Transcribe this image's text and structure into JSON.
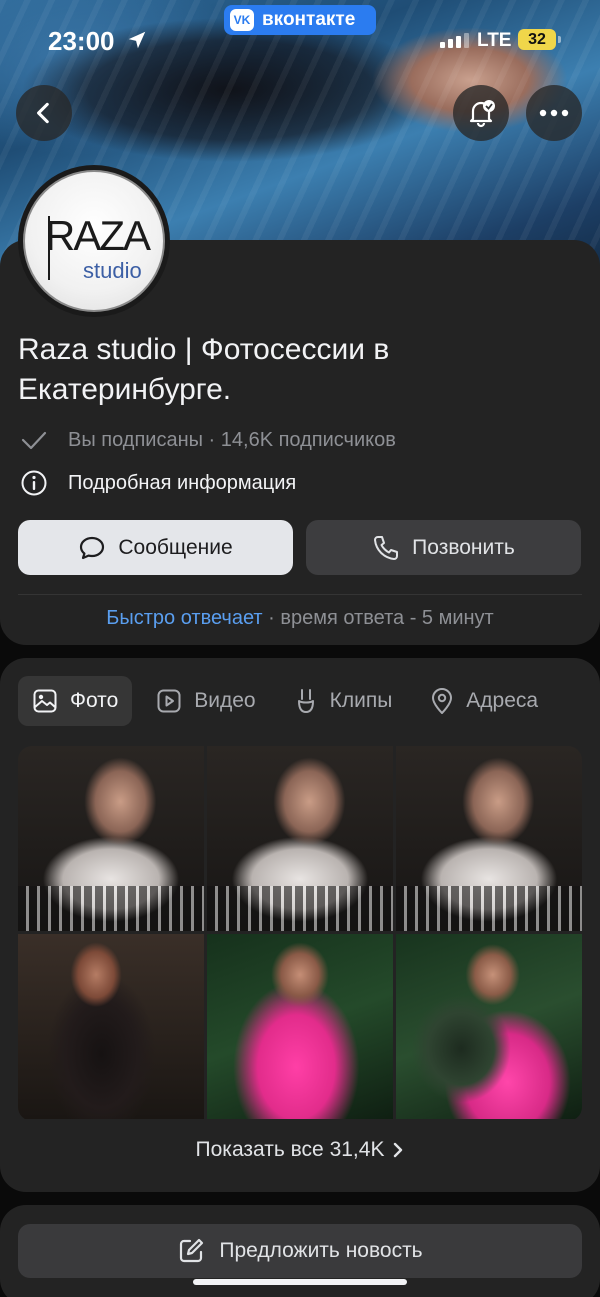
{
  "status_bar": {
    "time": "23:00",
    "app_pill": "вконтакте",
    "network": "LTE",
    "battery": "32"
  },
  "group": {
    "logo_text_top": "RAZA",
    "logo_text_bottom": "studio",
    "name": "Raza studio | Фотосессии в Екатеринбурге.",
    "subscription_line": "Вы подписаны · 14,6K подписчиков",
    "details_label": "Подробная информация"
  },
  "actions": {
    "message_label": "Сообщение",
    "call_label": "Позвонить"
  },
  "response": {
    "fast_label": "Быстро отвечает",
    "time_text": " · время ответа - 5 минут"
  },
  "media_tabs": [
    {
      "label": "Фото",
      "icon": "photo-icon",
      "active": true
    },
    {
      "label": "Видео",
      "icon": "video-icon",
      "active": false
    },
    {
      "label": "Клипы",
      "icon": "clips-icon",
      "active": false
    },
    {
      "label": "Адреса",
      "icon": "location-icon",
      "active": false
    }
  ],
  "photos": {
    "show_all_label": "Показать все 31,4K"
  },
  "suggest": {
    "label": "Предложить новость"
  },
  "colors": {
    "accent": "#5a9eef",
    "vk_blue": "#2b7cf0",
    "battery": "#f0d64a",
    "card_bg": "#232323"
  }
}
